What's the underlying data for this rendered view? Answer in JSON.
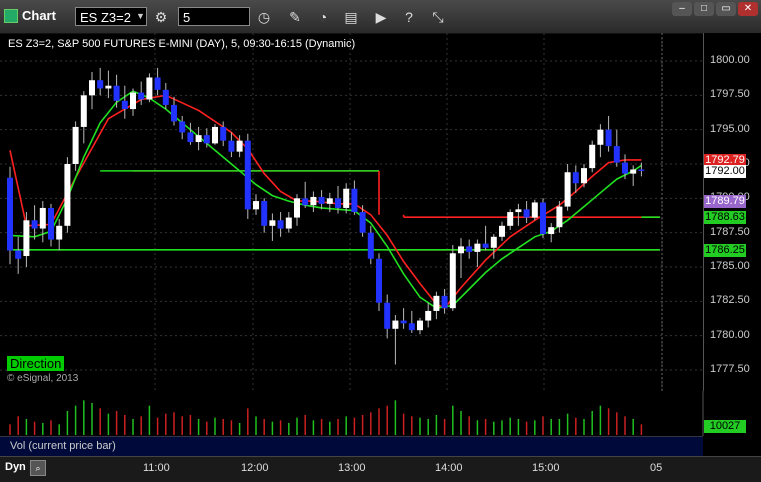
{
  "window": {
    "title": "Chart"
  },
  "toolbar": {
    "symbol": "ES Z3=2",
    "interval": "5"
  },
  "chart_header": "ES Z3=2, S&P 500 FUTURES E-MINI (DAY), 5, 09:30-16:15 (Dynamic)",
  "direction_label": "Direction",
  "copyright": "© eSignal, 2013",
  "volume_label": "Vol (current price bar)",
  "volume_value": "10027",
  "mode_label": "Dyn",
  "colors": {
    "up": "#ffffff",
    "down": "#2233ff",
    "red_line": "#ff2020",
    "green_line": "#20e020",
    "vol_up": "#20c020",
    "vol_down": "#cc2020"
  },
  "chart_data": {
    "type": "candlestick",
    "ylim": [
      1776.5,
      1802.5
    ],
    "y_ticks": [
      "1800.00",
      "1797.50",
      "1795.00",
      "1792.50",
      "1790.00",
      "1787.50",
      "1785.00",
      "1782.50",
      "1780.00",
      "1777.50"
    ],
    "x_ticks": [
      "11:00",
      "12:00",
      "13:00",
      "14:00",
      "15:00",
      "05"
    ],
    "price_labels": [
      {
        "text": "1792.79",
        "value": 1792.79,
        "bg": "#dd2222",
        "fg": "#ffffff"
      },
      {
        "text": "1792.00",
        "value": 1792.0,
        "bg": "#ffffff",
        "fg": "#000000"
      },
      {
        "text": "1789.79",
        "value": 1789.79,
        "bg": "#9966cc",
        "fg": "#ffffff"
      },
      {
        "text": "1788.63",
        "value": 1788.63,
        "bg": "#22cc22",
        "fg": "#000000"
      },
      {
        "text": "1786.25",
        "value": 1786.25,
        "bg": "#22cc22",
        "fg": "#000000"
      }
    ],
    "candles": [
      [
        1791.5,
        1792.3,
        1785.2,
        1786.2
      ],
      [
        1786.2,
        1787.2,
        1784.5,
        1785.6
      ],
      [
        1785.8,
        1789.0,
        1785.0,
        1788.4
      ],
      [
        1788.4,
        1789.5,
        1787.0,
        1787.8
      ],
      [
        1787.8,
        1789.8,
        1786.8,
        1789.3
      ],
      [
        1789.3,
        1789.6,
        1786.5,
        1787.0
      ],
      [
        1787.0,
        1788.5,
        1786.2,
        1788.0
      ],
      [
        1788.0,
        1793.0,
        1787.5,
        1792.5
      ],
      [
        1792.5,
        1795.6,
        1792.0,
        1795.2
      ],
      [
        1795.2,
        1797.8,
        1794.0,
        1797.5
      ],
      [
        1797.5,
        1799.2,
        1796.5,
        1798.6
      ],
      [
        1798.6,
        1799.5,
        1797.5,
        1798.0
      ],
      [
        1798.0,
        1799.3,
        1797.3,
        1798.2
      ],
      [
        1798.2,
        1799.0,
        1796.6,
        1797.1
      ],
      [
        1797.1,
        1798.2,
        1795.8,
        1796.5
      ],
      [
        1796.5,
        1798.0,
        1796.0,
        1797.7
      ],
      [
        1797.7,
        1798.5,
        1796.8,
        1797.2
      ],
      [
        1797.2,
        1799.1,
        1797.0,
        1798.8
      ],
      [
        1798.8,
        1799.5,
        1797.5,
        1797.9
      ],
      [
        1797.9,
        1798.4,
        1796.5,
        1796.8
      ],
      [
        1796.8,
        1797.4,
        1795.3,
        1795.6
      ],
      [
        1795.6,
        1796.0,
        1794.3,
        1794.8
      ],
      [
        1794.8,
        1795.5,
        1793.9,
        1794.1
      ],
      [
        1794.1,
        1795.2,
        1793.5,
        1794.6
      ],
      [
        1794.6,
        1795.1,
        1793.7,
        1794.0
      ],
      [
        1794.0,
        1795.4,
        1793.9,
        1795.2
      ],
      [
        1795.2,
        1795.6,
        1793.8,
        1794.2
      ],
      [
        1794.2,
        1794.8,
        1793.0,
        1793.4
      ],
      [
        1793.4,
        1794.6,
        1793.0,
        1794.2
      ],
      [
        1794.2,
        1794.7,
        1788.5,
        1789.2
      ],
      [
        1789.2,
        1790.3,
        1788.8,
        1789.8
      ],
      [
        1789.8,
        1790.0,
        1787.5,
        1788.0
      ],
      [
        1788.0,
        1788.9,
        1786.9,
        1788.4
      ],
      [
        1788.4,
        1789.0,
        1787.2,
        1787.8
      ],
      [
        1787.8,
        1789.0,
        1787.5,
        1788.6
      ],
      [
        1788.6,
        1790.3,
        1788.0,
        1790.0
      ],
      [
        1790.0,
        1791.2,
        1789.3,
        1789.5
      ],
      [
        1789.5,
        1790.5,
        1789.0,
        1790.1
      ],
      [
        1790.1,
        1790.6,
        1789.2,
        1789.6
      ],
      [
        1789.6,
        1790.4,
        1789.0,
        1790.0
      ],
      [
        1790.0,
        1790.9,
        1788.9,
        1789.3
      ],
      [
        1789.3,
        1791.1,
        1788.9,
        1790.7
      ],
      [
        1790.7,
        1791.3,
        1788.8,
        1789.0
      ],
      [
        1789.0,
        1789.5,
        1787.2,
        1787.5
      ],
      [
        1787.5,
        1788.0,
        1785.2,
        1785.6
      ],
      [
        1785.6,
        1786.0,
        1781.8,
        1782.4
      ],
      [
        1782.4,
        1783.0,
        1779.8,
        1780.5
      ],
      [
        1780.5,
        1781.5,
        1777.9,
        1781.1
      ],
      [
        1781.1,
        1782.0,
        1780.5,
        1780.9
      ],
      [
        1780.9,
        1781.8,
        1780.2,
        1780.4
      ],
      [
        1780.4,
        1781.3,
        1780.1,
        1781.1
      ],
      [
        1781.1,
        1782.4,
        1780.6,
        1781.8
      ],
      [
        1781.8,
        1783.2,
        1781.2,
        1782.9
      ],
      [
        1782.9,
        1783.4,
        1781.6,
        1782.0
      ],
      [
        1782.0,
        1786.6,
        1781.8,
        1786.0
      ],
      [
        1786.0,
        1787.1,
        1784.2,
        1786.5
      ],
      [
        1786.5,
        1787.0,
        1785.6,
        1786.1
      ],
      [
        1786.1,
        1787.0,
        1785.0,
        1786.7
      ],
      [
        1786.7,
        1788.0,
        1786.2,
        1786.4
      ],
      [
        1786.4,
        1787.4,
        1785.6,
        1787.2
      ],
      [
        1787.2,
        1788.3,
        1786.9,
        1788.0
      ],
      [
        1788.0,
        1789.2,
        1787.7,
        1789.0
      ],
      [
        1789.0,
        1789.6,
        1788.0,
        1789.2
      ],
      [
        1789.2,
        1789.8,
        1788.2,
        1788.6
      ],
      [
        1788.6,
        1789.9,
        1788.4,
        1789.7
      ],
      [
        1789.7,
        1790.0,
        1787.1,
        1787.4
      ],
      [
        1787.4,
        1788.2,
        1786.8,
        1787.9
      ],
      [
        1787.9,
        1789.8,
        1787.5,
        1789.4
      ],
      [
        1789.4,
        1792.5,
        1789.1,
        1791.9
      ],
      [
        1791.9,
        1792.4,
        1790.4,
        1791.1
      ],
      [
        1791.1,
        1792.5,
        1790.8,
        1792.2
      ],
      [
        1792.2,
        1794.2,
        1791.9,
        1793.9
      ],
      [
        1793.9,
        1795.4,
        1793.0,
        1795.0
      ],
      [
        1795.0,
        1796.0,
        1793.4,
        1793.8
      ],
      [
        1793.8,
        1795.0,
        1792.3,
        1792.6
      ],
      [
        1792.6,
        1793.2,
        1791.4,
        1791.8
      ],
      [
        1791.8,
        1792.4,
        1790.9,
        1792.1
      ],
      [
        1792.1,
        1792.6,
        1791.6,
        1792.0
      ]
    ],
    "red_line": [
      [
        0,
        1793.5
      ],
      [
        2,
        1788.0
      ],
      [
        5,
        1788.1
      ],
      [
        8,
        1791.5
      ],
      [
        12,
        1795.8
      ],
      [
        16,
        1797.2
      ],
      [
        19,
        1797.5
      ],
      [
        23,
        1796.4
      ],
      [
        27,
        1794.8
      ],
      [
        29,
        1793.6
      ],
      [
        31,
        1791.8
      ],
      [
        33,
        1790.5
      ],
      [
        35,
        1789.8
      ],
      [
        37,
        1789.8
      ],
      [
        40,
        1789.6
      ],
      [
        42,
        1789.6
      ],
      [
        44,
        1788.8
      ],
      [
        46,
        1787.3
      ],
      [
        48,
        1785.4
      ],
      [
        50,
        1783.8
      ],
      [
        52,
        1782.3
      ],
      [
        53,
        1782.0
      ],
      [
        55,
        1783.5
      ],
      [
        58,
        1785.5
      ],
      [
        61,
        1787.2
      ],
      [
        64,
        1788.4
      ],
      [
        67,
        1789.5
      ],
      [
        69,
        1790.5
      ],
      [
        71,
        1791.6
      ],
      [
        73,
        1792.6
      ],
      [
        75,
        1792.8
      ],
      [
        77,
        1792.8
      ]
    ],
    "green_line": [
      [
        0,
        1787.3
      ],
      [
        3,
        1787.2
      ],
      [
        5,
        1787.6
      ],
      [
        7,
        1790.0
      ],
      [
        9,
        1793.0
      ],
      [
        11,
        1795.5
      ],
      [
        13,
        1797.0
      ],
      [
        15,
        1797.8
      ],
      [
        17,
        1797.3
      ],
      [
        19,
        1796.5
      ],
      [
        22,
        1795.0
      ],
      [
        25,
        1793.5
      ],
      [
        28,
        1792.0
      ],
      [
        30,
        1791.0
      ],
      [
        32,
        1790.2
      ],
      [
        34,
        1789.8
      ],
      [
        36,
        1789.5
      ],
      [
        38,
        1789.3
      ],
      [
        40,
        1789.2
      ],
      [
        42,
        1789.1
      ],
      [
        44,
        1788.2
      ],
      [
        46,
        1786.5
      ],
      [
        48,
        1784.5
      ],
      [
        50,
        1782.8
      ],
      [
        52,
        1782.0
      ],
      [
        54,
        1782.2
      ],
      [
        56,
        1783.4
      ],
      [
        58,
        1784.6
      ],
      [
        60,
        1785.6
      ],
      [
        62,
        1786.4
      ],
      [
        64,
        1787.2
      ],
      [
        66,
        1787.6
      ],
      [
        68,
        1788.4
      ],
      [
        70,
        1789.4
      ],
      [
        72,
        1790.4
      ],
      [
        74,
        1791.4
      ],
      [
        76,
        1792.0
      ],
      [
        77,
        1792.4
      ]
    ],
    "hlines": [
      {
        "color": "red",
        "x0": 45,
        "x1": 46,
        "value": 1792.0,
        "from": 15,
        "to": 45
      },
      {
        "color": "red",
        "value": 1788.63,
        "from": 48,
        "to": 80
      },
      {
        "color": "red",
        "value": 1786.25,
        "from": 46,
        "to": 80
      },
      {
        "color": "green",
        "value": 1792.0,
        "from": 11,
        "to": 45
      },
      {
        "color": "green",
        "value": 1788.63,
        "from": 77,
        "to": 80
      },
      {
        "color": "green",
        "value": 1786.25,
        "from": 0,
        "to": 80
      }
    ],
    "volume": [
      8,
      14,
      12,
      10,
      9,
      11,
      8,
      18,
      22,
      26,
      24,
      20,
      16,
      18,
      15,
      12,
      14,
      22,
      13,
      16,
      17,
      14,
      15,
      12,
      10,
      13,
      12,
      11,
      9,
      20,
      14,
      12,
      10,
      11,
      9,
      13,
      15,
      11,
      12,
      10,
      12,
      14,
      13,
      15,
      17,
      20,
      22,
      26,
      16,
      14,
      13,
      12,
      15,
      12,
      22,
      18,
      14,
      11,
      12,
      10,
      11,
      13,
      12,
      10,
      11,
      14,
      12,
      12,
      16,
      13,
      12,
      18,
      22,
      20,
      17,
      14,
      12,
      8
    ]
  }
}
